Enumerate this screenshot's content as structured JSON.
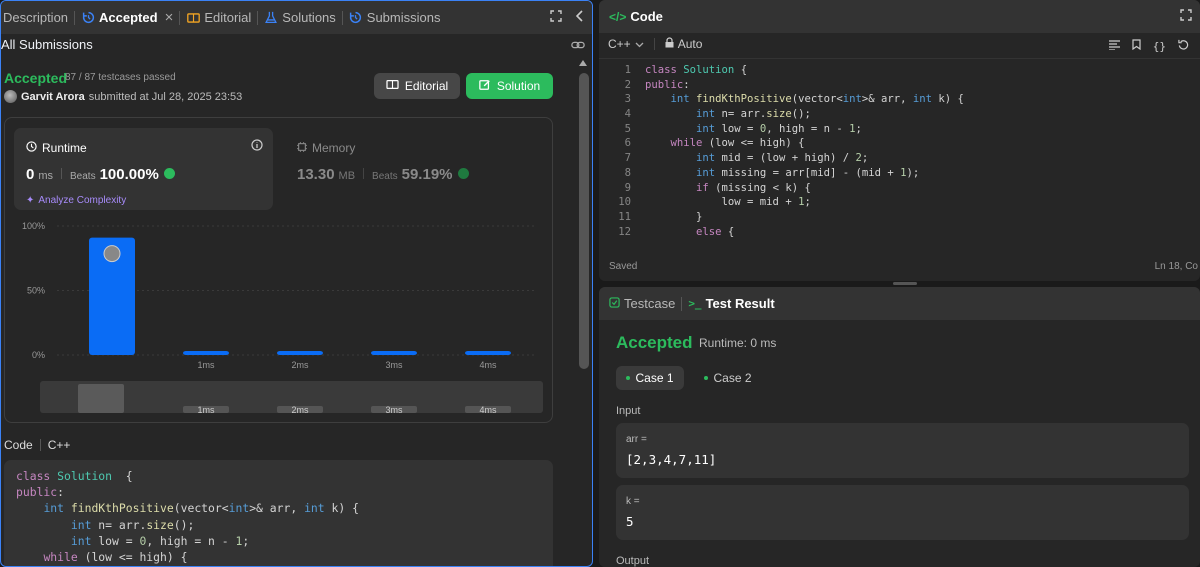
{
  "left": {
    "tabs": [
      {
        "label": "Description",
        "icon": "description-icon"
      },
      {
        "label": "Accepted",
        "icon": "history-icon"
      },
      {
        "label": "Editorial",
        "icon": "book-icon"
      },
      {
        "label": "Solutions",
        "icon": "flask-icon"
      },
      {
        "label": "Submissions",
        "icon": "history-icon"
      }
    ],
    "close_glyph": "×",
    "all_submissions": "All Submissions",
    "status": "Accepted",
    "testcases": "87 / 87 testcases passed",
    "user": "Garvit Arora",
    "submitted": "submitted at Jul 28, 2025 23:53",
    "editorial_btn": "Editorial",
    "solution_btn": "Solution",
    "runtime": {
      "label": "Runtime",
      "value": "0",
      "unit": "ms",
      "beats_label": "Beats",
      "beats": "100.00%",
      "analyze": "Analyze Complexity"
    },
    "memory": {
      "label": "Memory",
      "value": "13.30",
      "unit": "MB",
      "beats_label": "Beats",
      "beats": "59.19%"
    },
    "code_label": "Code",
    "lang": "C++"
  },
  "chart_data": {
    "type": "bar",
    "categories": [
      "0ms",
      "1ms",
      "2ms",
      "3ms",
      "4ms"
    ],
    "category_labels": [
      "",
      "1ms",
      "2ms",
      "3ms",
      "4ms"
    ],
    "values": [
      91,
      2,
      2,
      2,
      2
    ],
    "yticks": [
      "100%",
      "50%",
      "0%"
    ],
    "ylim": [
      0,
      100
    ],
    "grid": true,
    "color": "#0a6cf5",
    "minimap_labels": [
      "1ms",
      "2ms",
      "3ms",
      "4ms"
    ]
  },
  "left_code": [
    [
      [
        "kw",
        "class "
      ],
      [
        "cl",
        "Solution"
      ],
      [
        "",
        "  {"
      ]
    ],
    [
      [
        "kw",
        "public"
      ],
      [
        "",
        ":"
      ]
    ],
    [
      [
        "",
        "    "
      ],
      [
        "ty",
        "int "
      ],
      [
        "fn",
        "findKthPositive"
      ],
      [
        "",
        "(vector<"
      ],
      [
        "ty",
        "int"
      ],
      [
        "",
        ">& arr, "
      ],
      [
        "ty",
        "int"
      ],
      [
        "",
        " k) {"
      ]
    ],
    [
      [
        "",
        "        "
      ],
      [
        "ty",
        "int"
      ],
      [
        "",
        " n= arr."
      ],
      [
        "fn",
        "size"
      ],
      [
        "",
        "();"
      ]
    ],
    [
      [
        "",
        "        "
      ],
      [
        "ty",
        "int"
      ],
      [
        "",
        " low = "
      ],
      [
        "nu",
        "0"
      ],
      [
        "",
        ", high = n - "
      ],
      [
        "nu",
        "1"
      ],
      [
        "",
        ";"
      ]
    ],
    [
      [
        "",
        "    "
      ],
      [
        "kw",
        "while"
      ],
      [
        "",
        " (low <= high) {"
      ]
    ]
  ],
  "code_panel": {
    "title": "Code",
    "lang": "C++",
    "auto": "Auto",
    "saved": "Saved",
    "cursor": "Ln 18, Co",
    "line_numbers": [
      "1",
      "2",
      "3",
      "4",
      "5",
      "6",
      "7",
      "8",
      "9",
      "10",
      "11",
      "12"
    ],
    "lines": [
      [
        [
          "kw",
          "class "
        ],
        [
          "cl",
          "Solution"
        ],
        [
          "",
          " {"
        ]
      ],
      [
        [
          "kw",
          "public"
        ],
        [
          "",
          ":"
        ]
      ],
      [
        [
          "",
          "    "
        ],
        [
          "ty",
          "int "
        ],
        [
          "fn",
          "findKthPositive"
        ],
        [
          "",
          "(vector<"
        ],
        [
          "ty",
          "int"
        ],
        [
          "",
          ">& arr, "
        ],
        [
          "ty",
          "int"
        ],
        [
          "",
          " k) {"
        ]
      ],
      [
        [
          "",
          "        "
        ],
        [
          "ty",
          "int"
        ],
        [
          "",
          " n= arr."
        ],
        [
          "fn",
          "size"
        ],
        [
          "",
          "();"
        ]
      ],
      [
        [
          "",
          "        "
        ],
        [
          "ty",
          "int"
        ],
        [
          "",
          " low = "
        ],
        [
          "nu",
          "0"
        ],
        [
          "",
          ", high = n - "
        ],
        [
          "nu",
          "1"
        ],
        [
          "",
          ";"
        ]
      ],
      [
        [
          "",
          "    "
        ],
        [
          "kw",
          "while"
        ],
        [
          "",
          " (low <= high) {"
        ]
      ],
      [
        [
          "",
          "        "
        ],
        [
          "ty",
          "int"
        ],
        [
          "",
          " mid = (low + high) / "
        ],
        [
          "nu",
          "2"
        ],
        [
          "",
          ";"
        ]
      ],
      [
        [
          "",
          "        "
        ],
        [
          "ty",
          "int"
        ],
        [
          "",
          " missing = arr[mid] - (mid + "
        ],
        [
          "nu",
          "1"
        ],
        [
          "",
          ");"
        ]
      ],
      [
        [
          "",
          "        "
        ],
        [
          "kw",
          "if"
        ],
        [
          "",
          " (missing < k) {"
        ]
      ],
      [
        [
          "",
          "            low = mid + "
        ],
        [
          "nu",
          "1"
        ],
        [
          "",
          ";"
        ]
      ],
      [
        [
          "",
          "        }"
        ]
      ],
      [
        [
          "",
          "        "
        ],
        [
          "kw",
          "else"
        ],
        [
          "",
          " {"
        ]
      ]
    ]
  },
  "test": {
    "tab_testcase": "Testcase",
    "tab_result": "Test Result",
    "status": "Accepted",
    "runtime": "Runtime: 0 ms",
    "cases": [
      "Case 1",
      "Case 2"
    ],
    "input_label": "Input",
    "arr_label": "arr =",
    "arr_value": "[2,3,4,7,11]",
    "k_label": "k =",
    "k_value": "5",
    "output_label": "Output"
  }
}
